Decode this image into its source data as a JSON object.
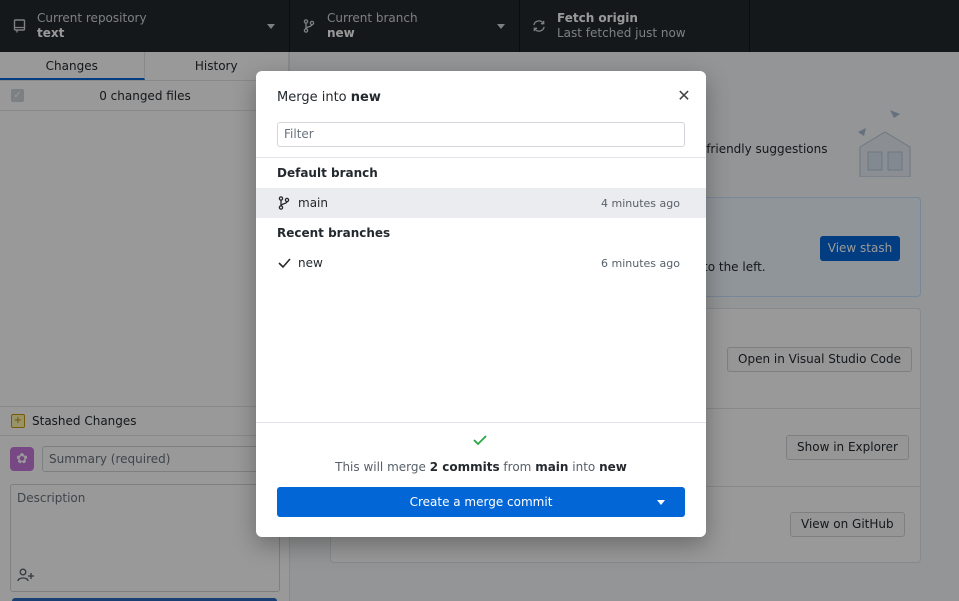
{
  "toolbar": {
    "repo": {
      "label": "Current repository",
      "value": "text",
      "icon": "repo-icon"
    },
    "branch": {
      "label": "Current branch",
      "value": "new",
      "icon": "git-branch-icon"
    },
    "fetch": {
      "label": "Fetch origin",
      "value": "Last fetched just now",
      "icon": "sync-icon"
    }
  },
  "sidebar": {
    "tabs": [
      "Changes",
      "History"
    ],
    "changed_files": "0 changed files",
    "stashed": "Stashed Changes",
    "summary_placeholder": "Summary (required)",
    "description_placeholder": "Description"
  },
  "main": {
    "suggest_tail": "e friendly suggestions",
    "stash_tail": "to the left.",
    "view_stash": "View stash",
    "open_editor": "Open in Visual Studio Code",
    "show_explorer": "Show in Explorer",
    "view_github": "View on GitHub"
  },
  "dialog": {
    "title_prefix": "Merge into",
    "title_branch": "new",
    "filter_placeholder": "Filter",
    "default_heading": "Default branch",
    "default_branch": {
      "name": "main",
      "time": "4 minutes ago"
    },
    "recent_heading": "Recent branches",
    "recent_branch": {
      "name": "new",
      "time": "6 minutes ago"
    },
    "merge_info": {
      "prefix": "This will merge",
      "count": "2 commits",
      "from_word": "from",
      "source": "main",
      "into_word": "into",
      "target": "new"
    },
    "merge_button": "Create a merge commit"
  },
  "colors": {
    "accent": "#0366d6",
    "toolbar": "#24292e",
    "success": "#28a745"
  }
}
